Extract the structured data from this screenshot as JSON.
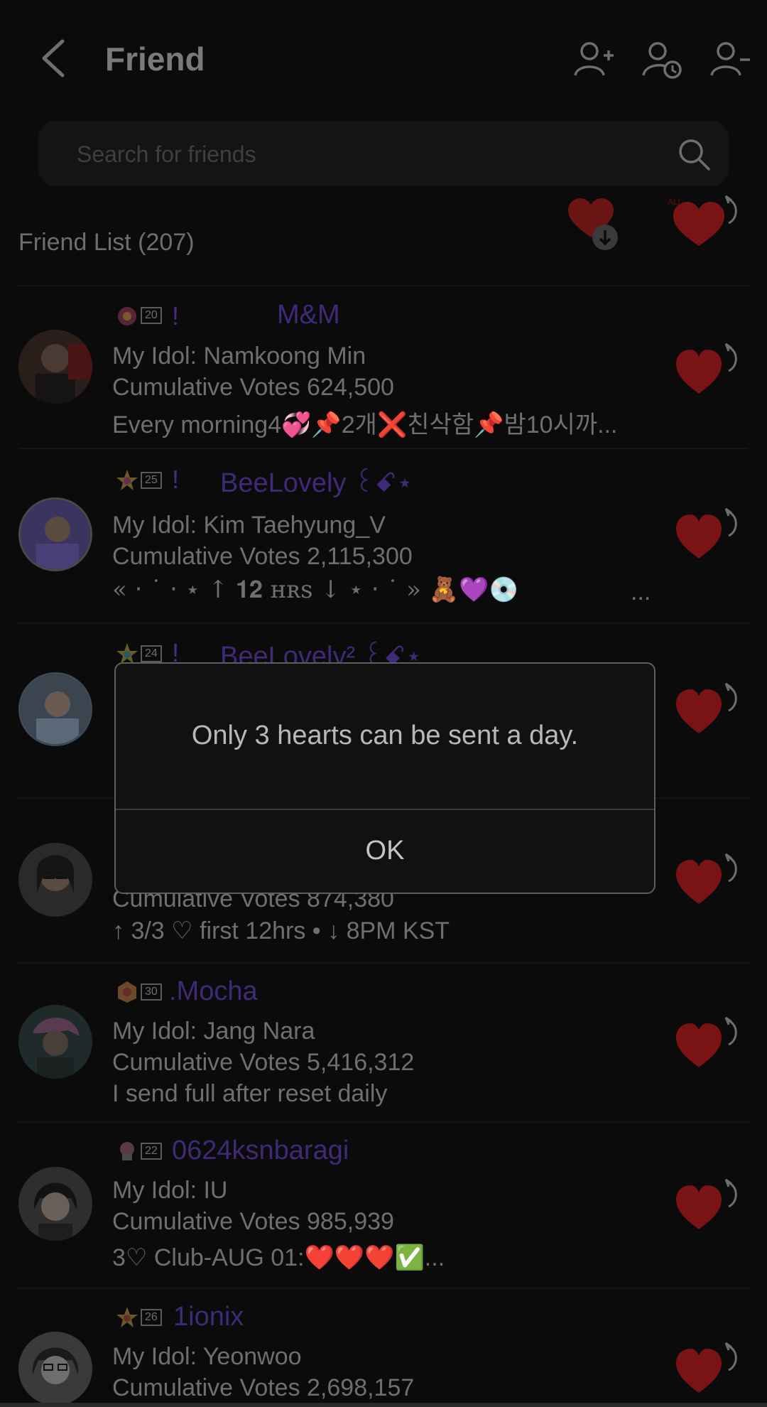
{
  "header": {
    "title": "Friend"
  },
  "search": {
    "placeholder": "Search for friends"
  },
  "list": {
    "title": "Friend List (207)"
  },
  "friends": [
    {
      "level": "20",
      "bang": "!",
      "nickname": "M&M",
      "idol": "My Idol: Namkoong Min",
      "votes": "Cumulative Votes 624,500",
      "status": "Every morning4💞📌2개❌친삭함📌밤10시까..."
    },
    {
      "level": "25",
      "bang": "!",
      "nickname": "BeeLovely ꒰ꗃ⋆",
      "idol": "My Idol: Kim Taehyung_V",
      "votes": "Cumulative Votes 2,115,300",
      "status": "« ‧ ˙ ‧ ⋆ ↑ 𝟏𝟐 ʜʀs ↓ ⋆ ‧ ˙ » 🧸💜💿"
    },
    {
      "level": "24",
      "bang": "!",
      "nickname": "BeeLovely² ꒰ꗃ⋆",
      "idol": "",
      "votes": "",
      "status": ""
    },
    {
      "level": "",
      "bang": "",
      "nickname": "",
      "idol": "",
      "votes": "Cumulative Votes 874,380",
      "status": "↑ 3/3 ♡ first 12hrs • ↓ 8PM KST"
    },
    {
      "level": "30",
      "bang": "",
      "nickname": ".Mocha",
      "idol": "My Idol: Jang Nara",
      "votes": "Cumulative Votes 5,416,312",
      "status": "I send full after reset daily"
    },
    {
      "level": "22",
      "bang": "",
      "nickname": "0624ksnbaragi",
      "idol": "My Idol: IU",
      "votes": "Cumulative Votes 985,939",
      "status": "3♡ Club-AUG 01:❤️❤️❤️✅..."
    },
    {
      "level": "26",
      "bang": "",
      "nickname": "1ionix",
      "idol": "My Idol: Yeonwoo",
      "votes": "Cumulative Votes 2,698,157",
      "status": ""
    }
  ],
  "dialog": {
    "message": "Only 3 hearts can be sent a day.",
    "ok": "OK"
  },
  "colors": {
    "heart": "#7a1414",
    "nickname": "#3f2a78",
    "dialog_bg": "#111111"
  }
}
